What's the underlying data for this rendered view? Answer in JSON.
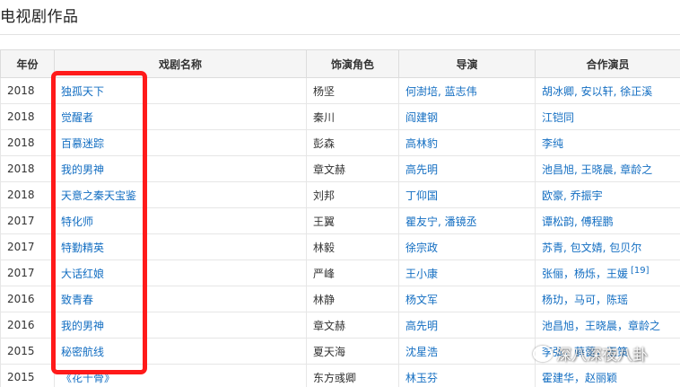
{
  "section": {
    "title": "电视剧作品"
  },
  "table": {
    "headers": [
      "年份",
      "戏剧名称",
      "饰演角色",
      "导演",
      "合作演员"
    ],
    "rows": [
      {
        "year": "2018",
        "name": "独孤天下",
        "role": "杨坚",
        "director": "何澍培, 蓝志伟",
        "costars": "胡冰卿, 安以轩, 徐正溪",
        "ref": ""
      },
      {
        "year": "2018",
        "name": "觉醒者",
        "role": "秦川",
        "director": "阎建钢",
        "costars": "江铠同",
        "ref": ""
      },
      {
        "year": "2018",
        "name": "百慕迷踪",
        "role": "彭森",
        "director": "高林豹",
        "costars": "李纯",
        "ref": ""
      },
      {
        "year": "2018",
        "name": "我的男神",
        "role": "章文赫",
        "director": "高先明",
        "costars": "池昌旭, 王晓晨, 章龄之",
        "ref": ""
      },
      {
        "year": "2018",
        "name": "天意之秦天宝鉴",
        "role": "刘邦",
        "director": "丁仰国",
        "costars": "欧豪, 乔振宇",
        "ref": ""
      },
      {
        "year": "2017",
        "name": "特化师",
        "role": "王翼",
        "director": "瞿友宁, 潘镜丞",
        "costars": "谭松韵, 傅程鹏",
        "ref": ""
      },
      {
        "year": "2017",
        "name": "特勤精英",
        "role": "林毅",
        "director": "徐宗政",
        "costars": "苏青, 包文婧, 包贝尔",
        "ref": ""
      },
      {
        "year": "2017",
        "name": "大话红娘",
        "role": "严峰",
        "director": "王小康",
        "costars": "张俪，杨烁，王媛",
        "ref": "[19]"
      },
      {
        "year": "2016",
        "name": "致青春",
        "role": "林静",
        "director": "杨文军",
        "costars": "杨玏，马可，陈瑶",
        "ref": ""
      },
      {
        "year": "2016",
        "name": "我的男神",
        "role": "章文赫",
        "director": "高先明",
        "costars": "池昌旭，王晓晨，章龄之",
        "ref": ""
      },
      {
        "year": "2015",
        "name": "秘密航线",
        "role": "夏天海",
        "director": "沈星浩",
        "costars": "李弘，薛蕾，王策",
        "ref": ""
      },
      {
        "year": "2015",
        "name": "《花千骨》",
        "role": "东方彧卿",
        "director": "林玉芬",
        "costars": "霍建华，赵丽颖",
        "ref": ""
      }
    ]
  },
  "annotation": {
    "highlight_color": "#ff1a1a"
  },
  "watermark": {
    "text": "深八深夜八卦",
    "icon": "speech-bubble-icon"
  },
  "colors": {
    "link": "#136ec2",
    "header_bg": "#f5f5f5",
    "text": "#333333"
  }
}
